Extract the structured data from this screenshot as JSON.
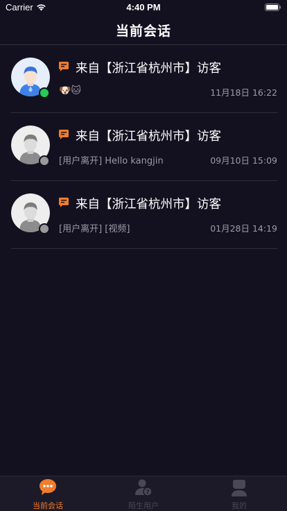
{
  "status_bar": {
    "carrier": "Carrier",
    "time": "4:40 PM"
  },
  "nav": {
    "title": "当前会话"
  },
  "colors": {
    "accent": "#f07c2e",
    "online": "#22cc55",
    "offline": "#9a9a9a",
    "background": "#13111f"
  },
  "conversations": [
    {
      "title": "来自【浙江省杭州市】访客",
      "preview": "🐶🐱",
      "time": "11月18日 16:22",
      "online": true,
      "avatar": "avatar-blue-icon"
    },
    {
      "title": "来自【浙江省杭州市】访客",
      "preview": "[用户离开] Hello kangjin",
      "time": "09月10日 15:09",
      "online": false,
      "avatar": "avatar-gray-icon"
    },
    {
      "title": "来自【浙江省杭州市】访客",
      "preview": "[用户离开] [视频]",
      "time": "01月28日 14:19",
      "online": false,
      "avatar": "avatar-gray-icon"
    }
  ],
  "tabs": [
    {
      "label": "当前会话",
      "icon": "chat-bubble-icon",
      "active": true
    },
    {
      "label": "陌生用户",
      "icon": "unknown-user-icon",
      "active": false
    },
    {
      "label": "我的",
      "icon": "profile-icon",
      "active": false
    }
  ]
}
